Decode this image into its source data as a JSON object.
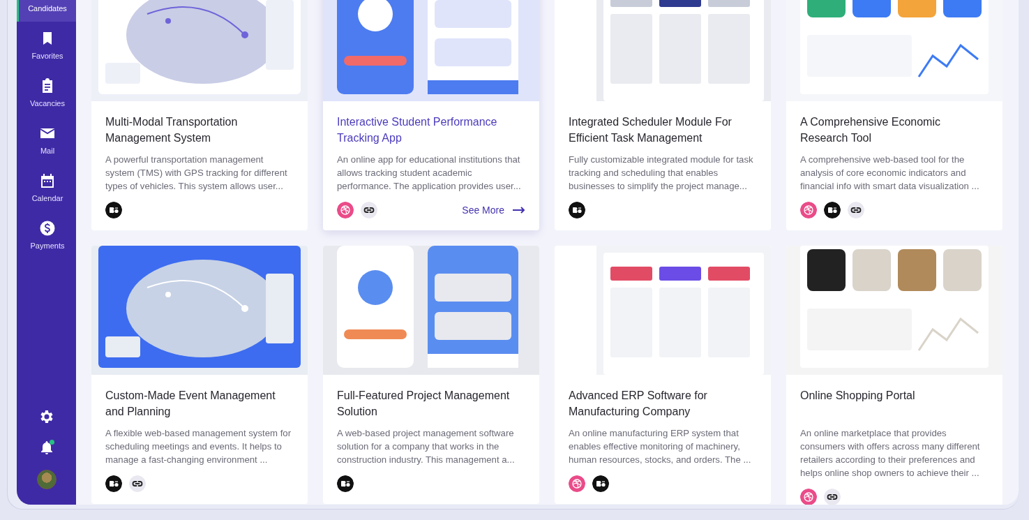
{
  "sidebar": {
    "items": [
      {
        "label": "Candidates",
        "selected": true
      },
      {
        "label": "Favorites",
        "selected": false
      },
      {
        "label": "Vacancies",
        "selected": false
      },
      {
        "label": "Mail",
        "selected": false
      },
      {
        "label": "Calendar",
        "selected": false
      },
      {
        "label": "Payments",
        "selected": false
      }
    ],
    "notifications": {
      "unread": true
    }
  },
  "projects": [
    {
      "title": "Multi-Modal Transportation Management System",
      "description": "A powerful transportation management system (TMS) with GPS tracking for different types of vehicles. This system allows user...",
      "hovered": false,
      "thumbnail": {
        "kind": "picture"
      },
      "links": [
        {
          "kind": "behance"
        }
      ]
    },
    {
      "title": "Interactive Student Performance Tracking App",
      "description": "An online app for educational institutions that allows tracking student academic performance. The application provides user...",
      "hovered": true,
      "thumbnail": {
        "kind": "picture"
      },
      "links": [
        {
          "kind": "dribbble"
        },
        {
          "kind": "link"
        }
      ],
      "action": "See More"
    },
    {
      "title": "Integrated Scheduler Module For Efficient Task Management",
      "description": "Fully customizable integrated module for task tracking and scheduling that enables businesses to simplify the project manage...",
      "hovered": false,
      "thumbnail": {
        "kind": "picture"
      },
      "links": [
        {
          "kind": "behance"
        }
      ]
    },
    {
      "title": "A Comprehensive Economic Research Tool",
      "description": "A comprehensive web-based tool for the analysis of core economic indicators and financial info with smart data visualization ...",
      "hovered": false,
      "thumbnail": {
        "kind": "picture"
      },
      "links": [
        {
          "kind": "dribbble"
        },
        {
          "kind": "behance"
        },
        {
          "kind": "link"
        }
      ]
    },
    {
      "title": "Custom-Made Event Management and Planning",
      "description": "A flexible web-based management system for scheduling meetings and events. It helps to manage a fast-changing environment ...",
      "hovered": false,
      "thumbnail": {
        "kind": "picture"
      },
      "links": [
        {
          "kind": "behance"
        },
        {
          "kind": "link"
        }
      ]
    },
    {
      "title": "Full-Featured Project Management Solution",
      "description": "A web-based project management software solution for a company that works in the construction industry. This management a...",
      "hovered": false,
      "thumbnail": {
        "kind": "picture"
      },
      "links": [
        {
          "kind": "behance"
        }
      ]
    },
    {
      "title": "Advanced ERP Software for Manufacturing Company",
      "description": "An online manufacturing ERP system that enables effective monitoring of machinery, human resources, stocks, and orders. The ...",
      "hovered": false,
      "thumbnail": {
        "kind": "picture"
      },
      "links": [
        {
          "kind": "dribbble"
        },
        {
          "kind": "behance"
        }
      ]
    },
    {
      "title": "Online Shopping Portal",
      "description": "An online marketplace that provides consumers with offers across many different retailers according to their preferences and helps online shop owners to achieve their ...",
      "hovered": false,
      "thumbnail": {
        "kind": "picture"
      },
      "links": [
        {
          "kind": "dribbble"
        },
        {
          "kind": "link"
        }
      ]
    }
  ]
}
